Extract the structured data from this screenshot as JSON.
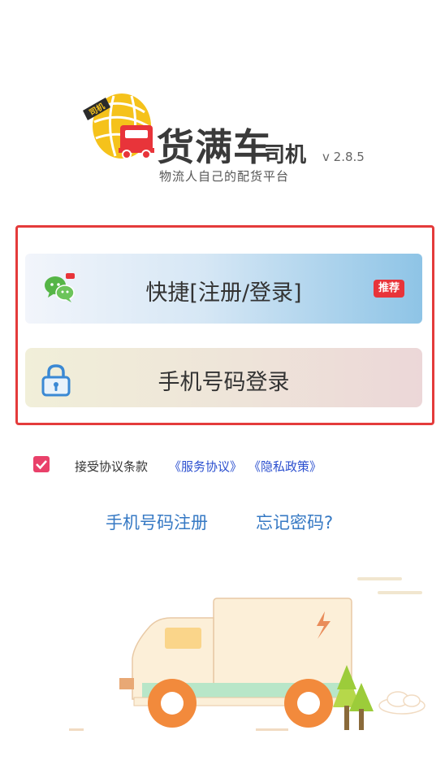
{
  "branding": {
    "name": "货满车",
    "sub": "司机",
    "badge_text": "司机",
    "version": "v 2.8.5",
    "slogan": "物流人自己的配货平台"
  },
  "login_options": {
    "quick_label": "快捷[注册/登录]",
    "recommend_badge": "推荐",
    "phone_label": "手机号码登录"
  },
  "agreement": {
    "checked": true,
    "text": "接受协议条款",
    "service_link": "《服务协议》",
    "privacy_link": "《隐私政策》"
  },
  "links": {
    "register": "手机号码注册",
    "forgot": "忘记密码?"
  },
  "colors": {
    "highlight": "#e43b3b",
    "link_blue": "#3679c4",
    "agreement_link": "#2b4fcf",
    "checkbox": "#e9416a",
    "logo_yellow": "#f5c21b",
    "logo_red": "#e8343a"
  }
}
